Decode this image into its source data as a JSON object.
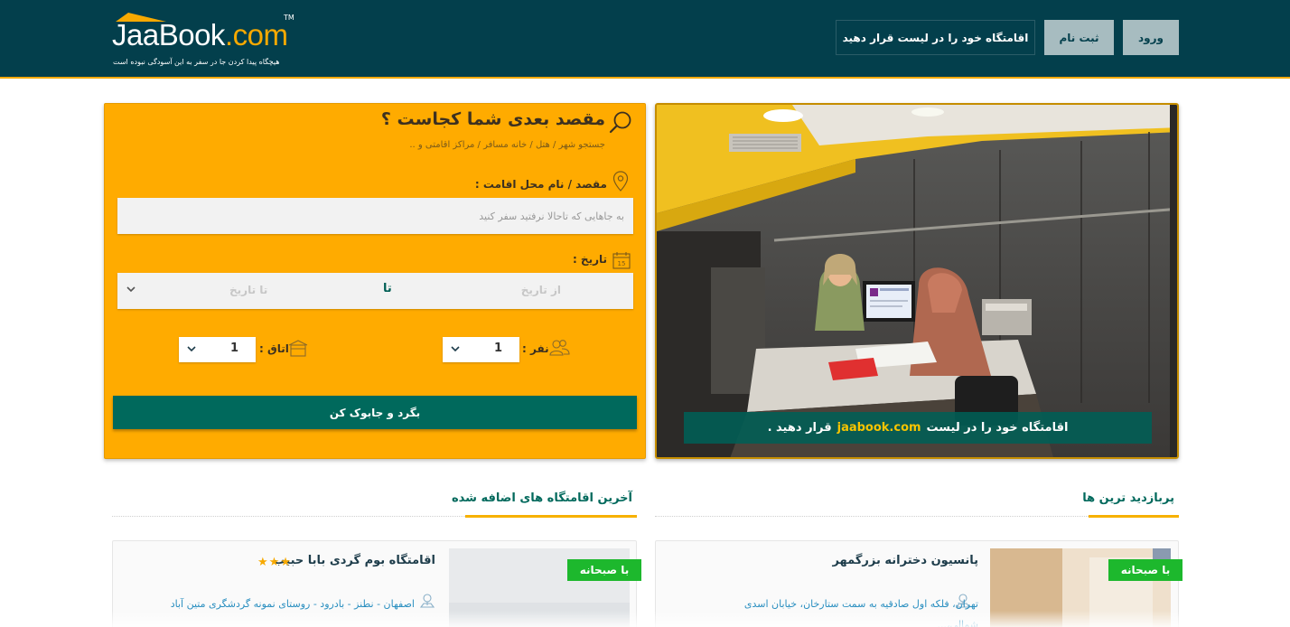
{
  "brand": {
    "logo_name": "JaaBook",
    "logo_tld": ".com",
    "trademark": "TM",
    "tagline": "هیچگاه پیدا کردن جا در سفر به این آسودگی نبوده است"
  },
  "header": {
    "login_label": "ورود",
    "register_label": "ثبت نام",
    "list_property_label": "اقامتگاه خود را در لیست قرار دهید"
  },
  "search": {
    "title": "مقصد بعدی شما کجاست ؟",
    "subtitle": "جستجو شهر / هتل / خانه مسافر / مراکز اقامتی و ..",
    "destination_label": "مقصد / نام محل اقامت :",
    "destination_placeholder": "به جاهایی که تاحالا نرفتید سفر کنید",
    "date_label": "تاریخ :",
    "date_from": "از تاریخ",
    "date_separator": "تا",
    "date_to": "تا تاریخ",
    "people_label": "نفر :",
    "people_value": "1",
    "room_label": "اتاق :",
    "room_value": "1",
    "submit_label": "بگرد و جابوک کن"
  },
  "hero": {
    "caption_before": "اقامتگاه خود را در لیست",
    "caption_brand": "jaabook.com",
    "caption_after": "قرار دهید ."
  },
  "sections": {
    "most_visited": "پربازدید ترین ها",
    "latest_added": "آخرین اقامتگاه های اضافه شده"
  },
  "cards": [
    {
      "title": "پانسیون دخترانه بزرگمهر",
      "badge": "با صبحانه",
      "address": "تهران، فلکه اول صادقیه به سمت ستارخان، خیابان اسدی شمالی،..."
    },
    {
      "title": "اقامتگاه بوم گردی بابا حبیب",
      "stars": "★★★",
      "badge": "با صبحانه",
      "address": "اصفهان - نطنز - بادرود - روستای نمونه گردشگری متین آباد"
    }
  ],
  "colors": {
    "header_bg": "#033f4c",
    "accent": "#ffab00",
    "primary": "#00695c",
    "badge": "#1db82d"
  }
}
